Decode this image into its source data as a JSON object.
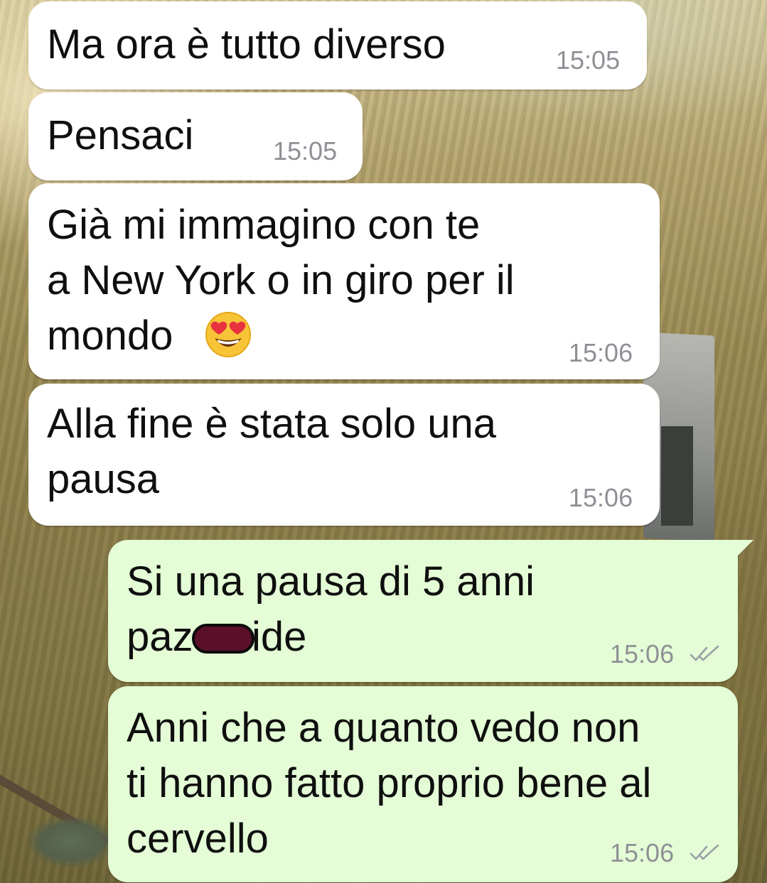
{
  "messages": [
    {
      "direction": "incoming",
      "text": "Ma ora è tutto diverso",
      "time": "15:05"
    },
    {
      "direction": "incoming",
      "text": "Pensaci",
      "time": "15:05"
    },
    {
      "direction": "incoming",
      "lines": [
        "Già mi immagino con te",
        "a New York o in giro per il",
        "mondo"
      ],
      "emoji": "smiling-face-with-heart-eyes",
      "time": "15:06"
    },
    {
      "direction": "incoming",
      "lines": [
        "Alla fine è stata solo una",
        "pausa"
      ],
      "time": "15:06"
    },
    {
      "direction": "outgoing",
      "line1": "Si una pausa di 5 anni",
      "line2_before": "paz",
      "line2_after": "ide",
      "redacted": true,
      "time": "15:06",
      "status_icon": "double-check-icon"
    },
    {
      "direction": "outgoing",
      "lines": [
        "Anni che a quanto vedo non",
        "ti hanno fatto proprio bene al",
        "cervello"
      ],
      "time": "15:06",
      "status_icon": "double-check-icon"
    }
  ],
  "colors": {
    "incoming_bubble": "#ffffff",
    "outgoing_bubble": "#e4fdd6",
    "timestamp": "#8f9096",
    "redaction": "#5a1028"
  }
}
